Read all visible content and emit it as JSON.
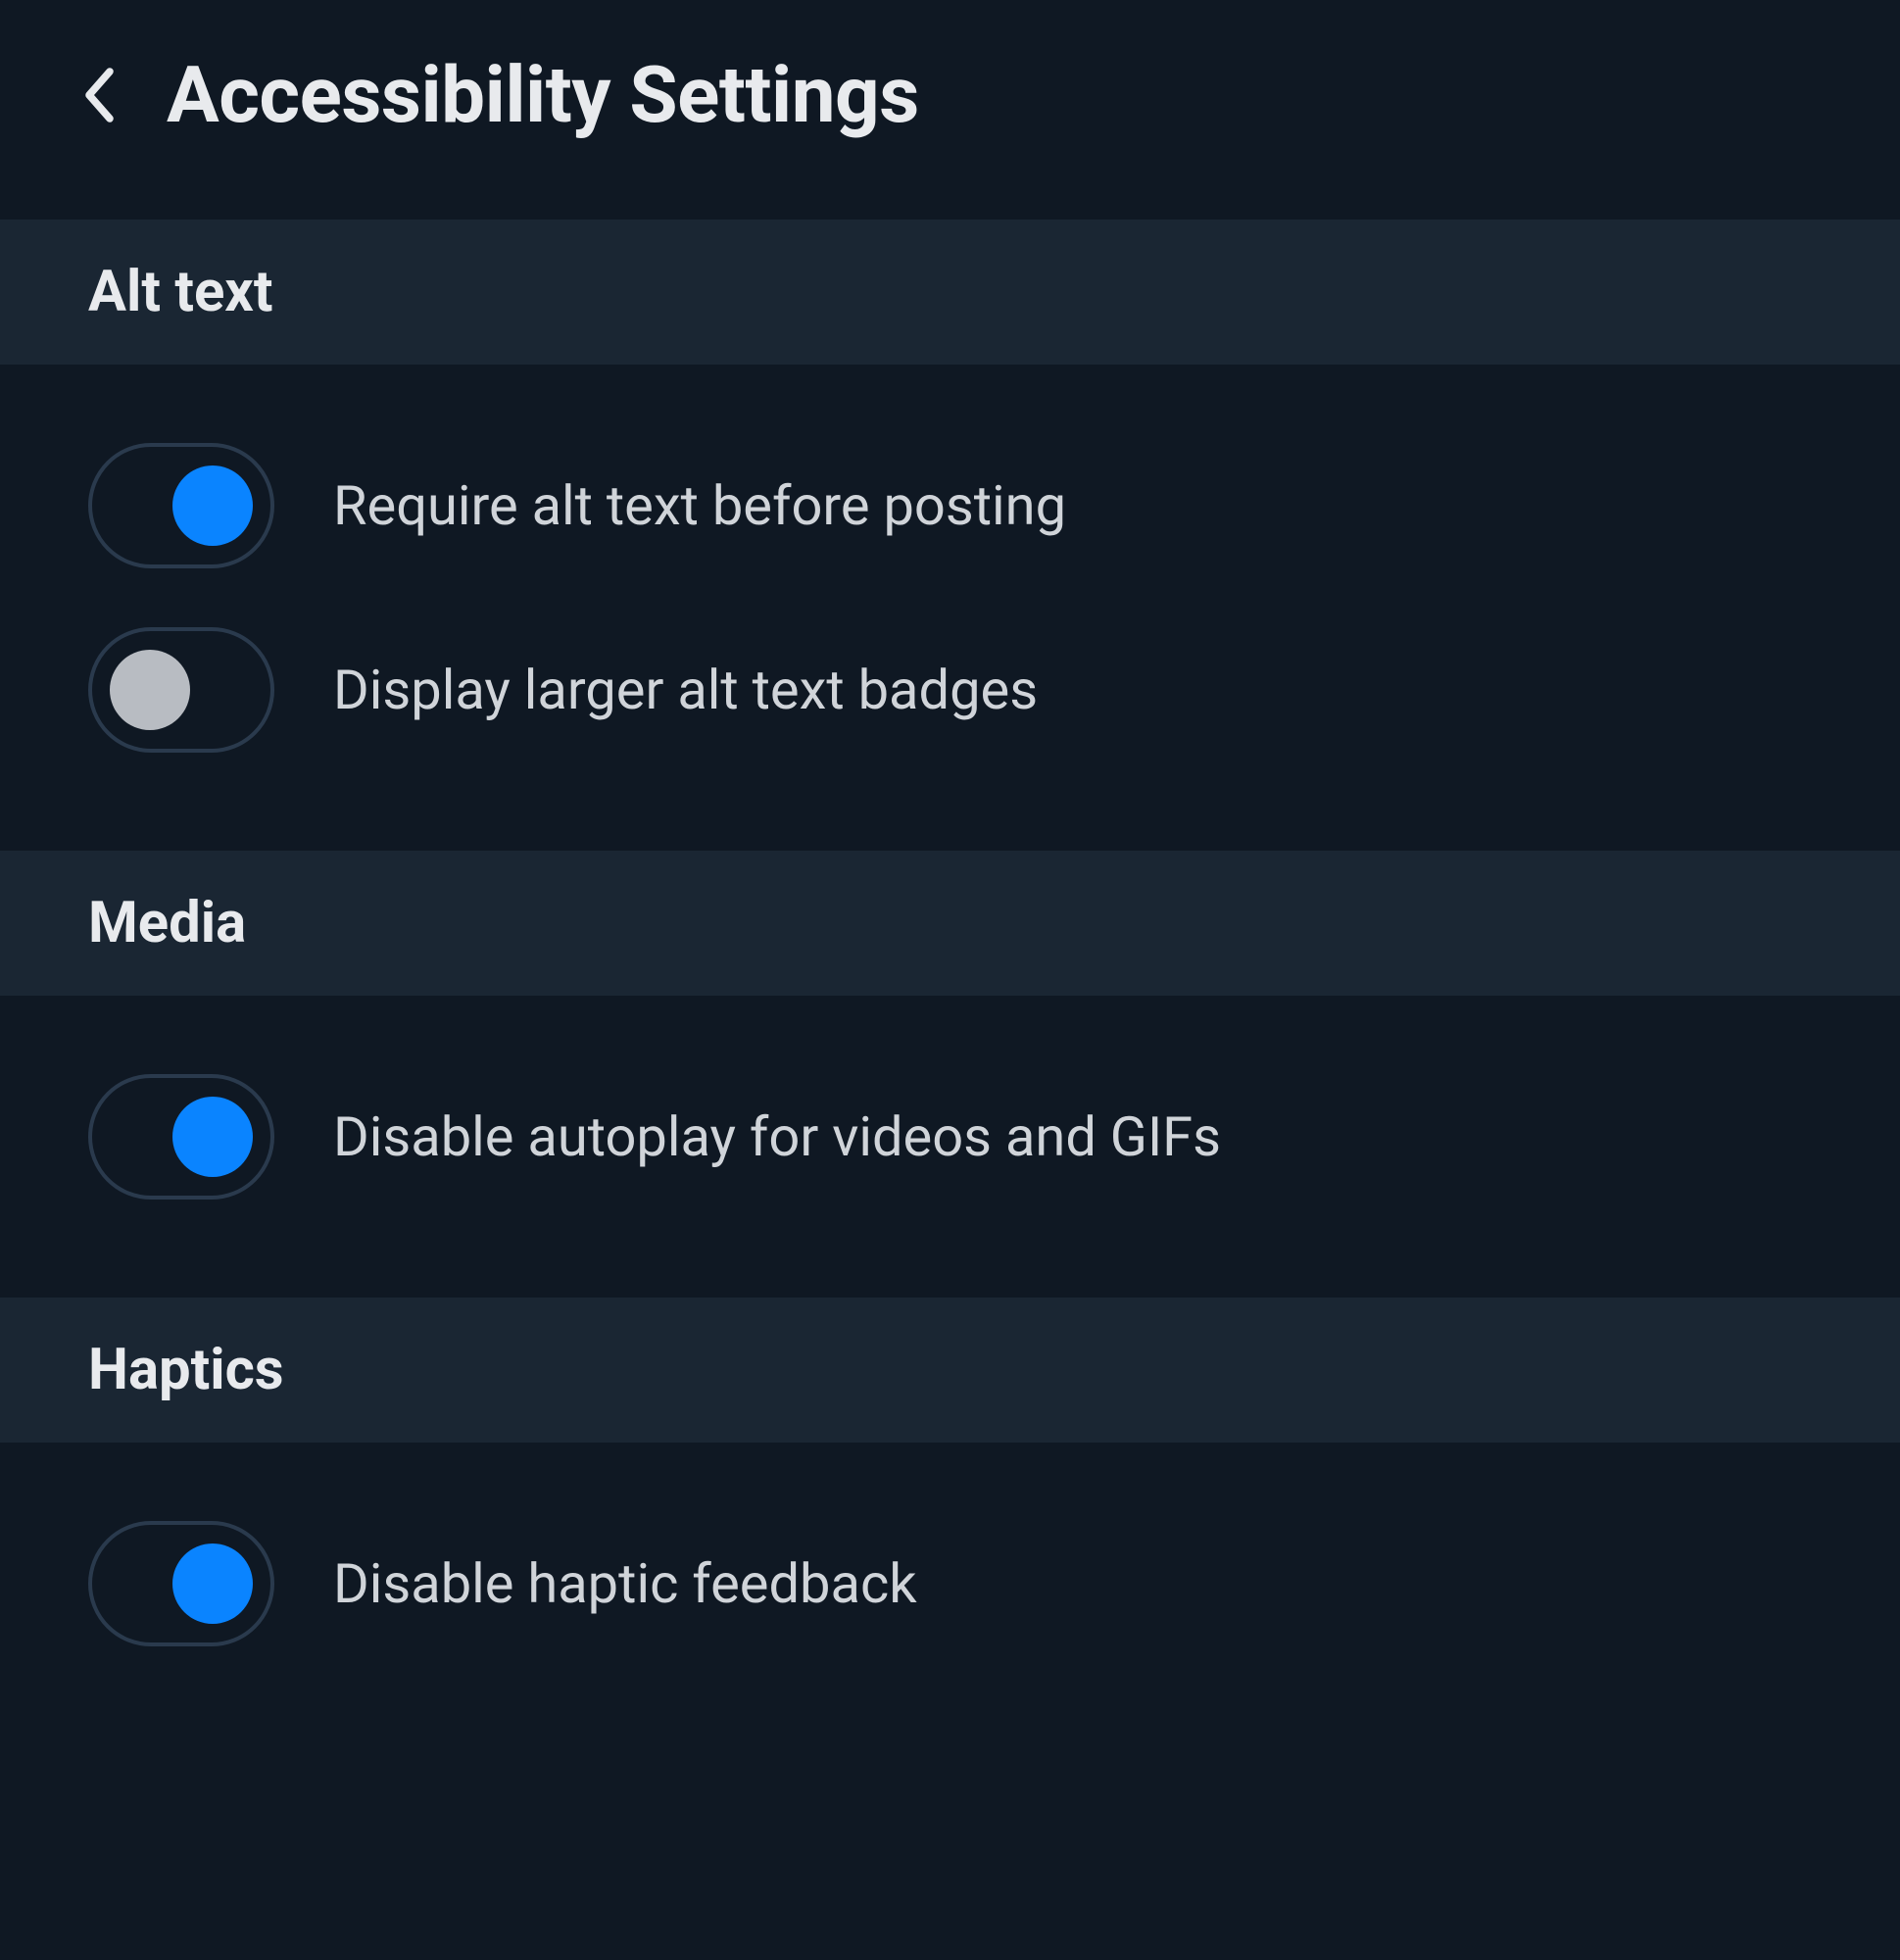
{
  "header": {
    "title": "Accessibility Settings"
  },
  "sections": [
    {
      "title": "Alt text",
      "settings": [
        {
          "label": "Require alt text before posting",
          "enabled": true
        },
        {
          "label": "Display larger alt text badges",
          "enabled": false
        }
      ]
    },
    {
      "title": "Media",
      "settings": [
        {
          "label": "Disable autoplay for videos and GIFs",
          "enabled": true
        }
      ]
    },
    {
      "title": "Haptics",
      "settings": [
        {
          "label": "Disable haptic feedback",
          "enabled": true
        }
      ]
    }
  ]
}
